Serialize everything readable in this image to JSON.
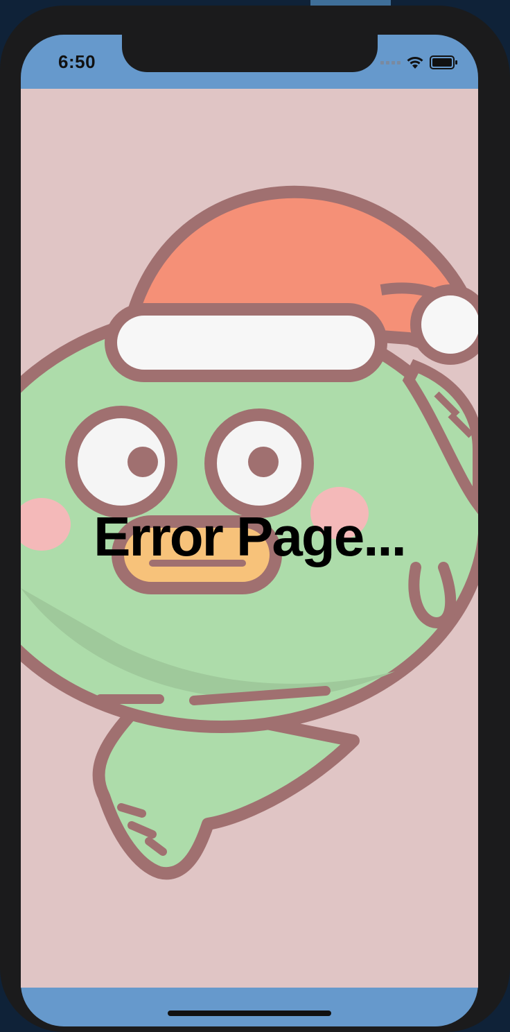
{
  "status_bar": {
    "time": "6:50",
    "icons": [
      "cellular-signal-icon",
      "wifi-icon",
      "battery-icon"
    ]
  },
  "main": {
    "title": "Error Page..."
  },
  "colors": {
    "status_bar_bg": "#6699cc",
    "content_bg": "#e0c5c5",
    "device_frame": "#1b1b1c"
  }
}
